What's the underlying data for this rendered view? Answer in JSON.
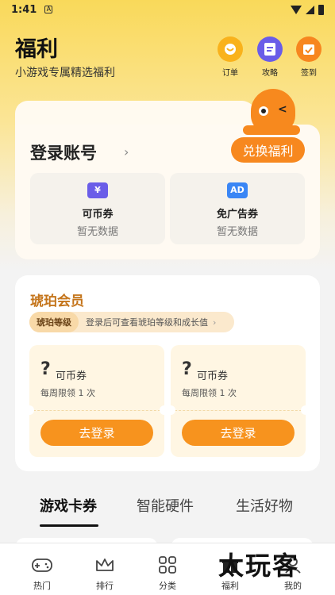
{
  "status_bar": {
    "time": "1:41"
  },
  "header": {
    "title": "福利",
    "subtitle": "小游戏专属精选福利",
    "icons": [
      {
        "name": "orders",
        "label": "订单",
        "color": "#f9b21c"
      },
      {
        "name": "guide",
        "label": "攻略",
        "color": "#6a5de8"
      },
      {
        "name": "checkin",
        "label": "签到",
        "color": "#f7861f"
      }
    ]
  },
  "login_card": {
    "title": "登录账号",
    "chevron": "›",
    "redeem_button": "兑换福利",
    "coupons": [
      {
        "icon": "¥",
        "title": "可币券",
        "status": "暂无数据",
        "color": "#6a5de8"
      },
      {
        "icon": "AD",
        "title": "免广告券",
        "status": "暂无数据",
        "color": "#3a86f5"
      }
    ]
  },
  "vip_card": {
    "title": "琥珀会员",
    "level_label": "琥珀等级",
    "level_hint": "登录后可查看琥珀等级和成长值",
    "tickets": [
      {
        "mark": "?",
        "name": "可币券",
        "limit": "每周限领 1 次",
        "button": "去登录"
      },
      {
        "mark": "?",
        "name": "可币券",
        "limit": "每周限领 1 次",
        "button": "去登录"
      }
    ]
  },
  "tabs": [
    "游戏卡券",
    "智能硬件",
    "生活好物"
  ],
  "bottom_nav": [
    {
      "label": "热门",
      "icon": "gamepad-icon"
    },
    {
      "label": "排行",
      "icon": "crown-icon"
    },
    {
      "label": "分类",
      "icon": "grid-icon"
    },
    {
      "label": "福利",
      "icon": "gift-icon"
    },
    {
      "label": "我的",
      "icon": "user-icon"
    }
  ],
  "watermark": "太玩客",
  "colors": {
    "accent": "#f7881f",
    "header_bg": "#f9d95a",
    "vip_title": "#c4741a"
  }
}
